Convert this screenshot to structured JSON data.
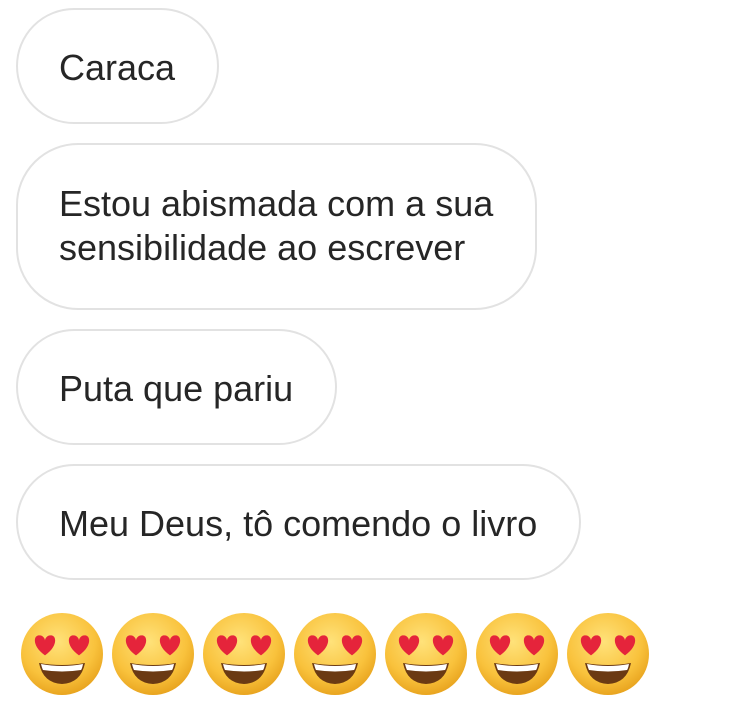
{
  "messages": [
    {
      "text": "Caraca"
    },
    {
      "text": "Estou abismada com a sua",
      "text2": "sensibilidade ao escrever"
    },
    {
      "text": "Puta que pariu"
    },
    {
      "text": "Meu Deus, tô comendo o livro"
    }
  ],
  "emoji_message": {
    "emojis": [
      "heart-eyes-emoji",
      "heart-eyes-emoji",
      "heart-eyes-emoji",
      "heart-eyes-emoji",
      "heart-eyes-emoji",
      "heart-eyes-emoji",
      "heart-eyes-emoji"
    ]
  },
  "colors": {
    "bubble_border": "#e2e2e2",
    "text": "#262626",
    "emoji_face": "#f9c23c",
    "emoji_heart": "#e5243b"
  }
}
